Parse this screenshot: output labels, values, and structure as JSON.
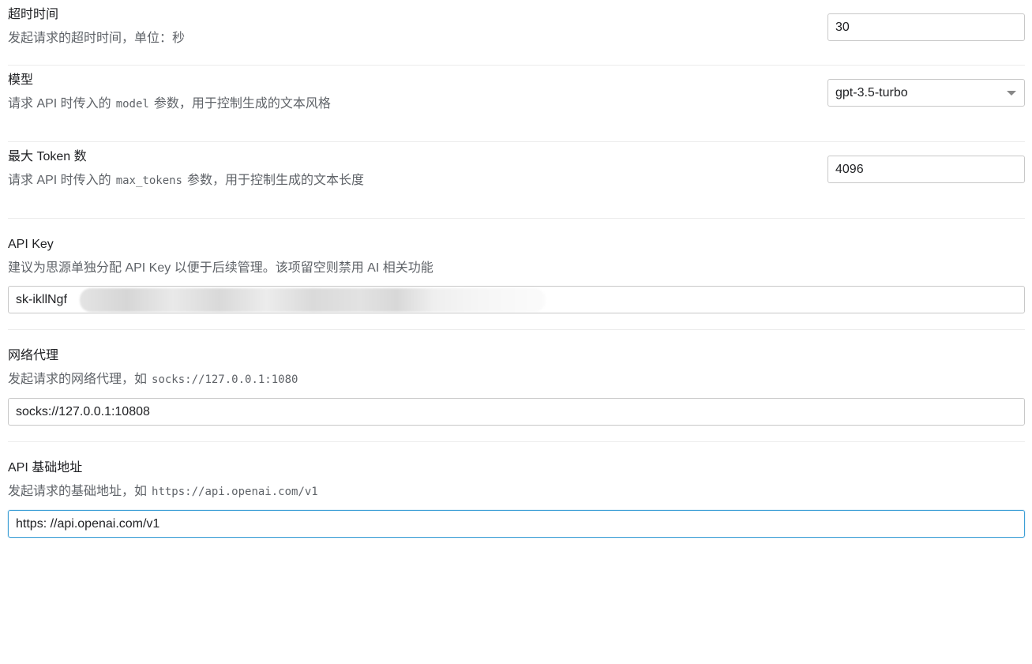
{
  "timeout": {
    "title": "超时时间",
    "desc": "发起请求的超时时间，单位：秒",
    "value": "30"
  },
  "model": {
    "title": "模型",
    "desc_prefix": "请求 API 时传入的",
    "desc_code": "model",
    "desc_suffix": "参数，用于控制生成的文本风格",
    "value": "gpt-3.5-turbo"
  },
  "max_tokens": {
    "title": "最大 Token 数",
    "desc_prefix": "请求 API 时传入的",
    "desc_code": "max_tokens",
    "desc_suffix": "参数，用于控制生成的文本长度",
    "value": "4096"
  },
  "api_key": {
    "title": "API Key",
    "desc": "建议为思源单独分配 API Key 以便于后续管理。该项留空则禁用 AI 相关功能",
    "value": "sk-ikllNgf"
  },
  "proxy": {
    "title": "网络代理",
    "desc_prefix": "发起请求的网络代理，如",
    "desc_code": "socks://127.0.0.1:1080",
    "value": "socks://127.0.0.1:10808"
  },
  "base_url": {
    "title": "API 基础地址",
    "desc_prefix": "发起请求的基础地址，如",
    "desc_code": "https://api.openai.com/v1",
    "value": "https: //api.openai.com/v1"
  }
}
